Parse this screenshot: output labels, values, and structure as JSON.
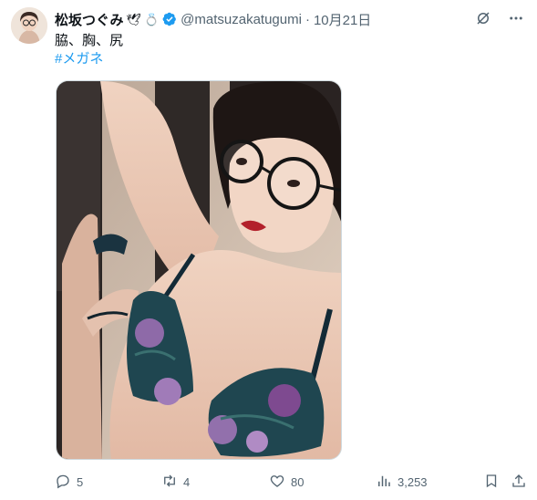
{
  "tweet": {
    "display_name": "松坂つぐみ",
    "name_emoji_1": "🕊",
    "name_emoji_2": "💍",
    "handle": "@matsuzakatugumi",
    "separator": "·",
    "date": "10月21日",
    "text": "脇、胸、尻",
    "hashtag": "#メガネ"
  },
  "metrics": {
    "replies": "5",
    "retweets": "4",
    "likes": "80",
    "views": "3,253"
  },
  "colors": {
    "accent": "#1d9bf0",
    "muted": "#536471",
    "text": "#0f1419"
  },
  "icons": [
    "avatar",
    "verified-badge-icon",
    "grok-icon",
    "more-icon",
    "reply-icon",
    "retweet-icon",
    "like-icon",
    "views-icon",
    "bookmark-icon",
    "share-icon"
  ]
}
